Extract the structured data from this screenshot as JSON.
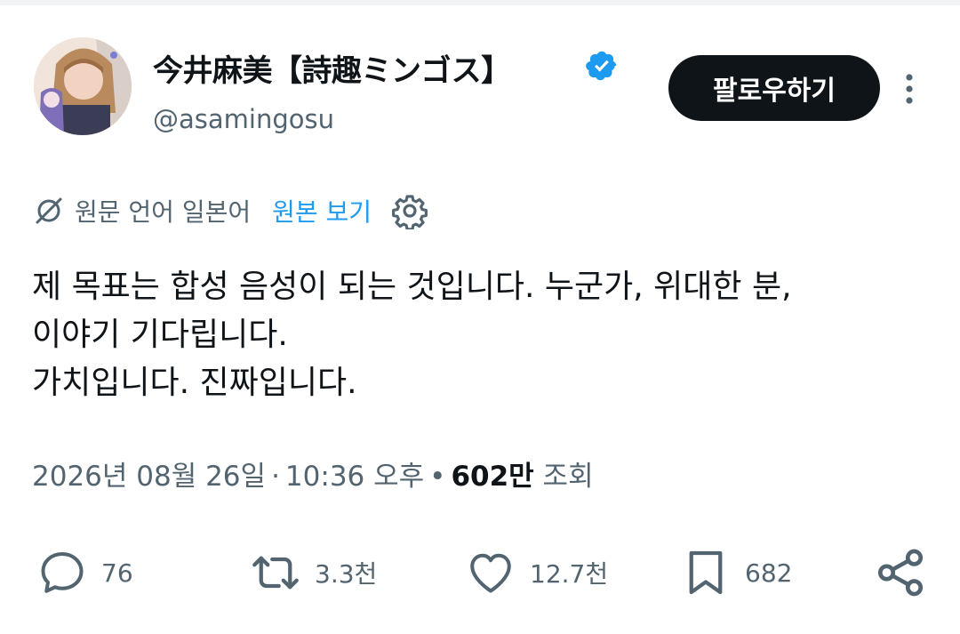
{
  "author": {
    "display_name": "今井麻美【詩趣ミンゴス】",
    "handle": "@asamingosu",
    "verified": true
  },
  "follow_button": {
    "label": "팔로우하기"
  },
  "translation": {
    "label": "원문 언어 일본어",
    "show_original_label": "원본 보기"
  },
  "tweet": {
    "lines": [
      "제 목표는 합성 음성이 되는 것입니다. 누군가, 위대한 분,",
      "이야기 기다립니다.",
      "가치입니다. 진짜입니다."
    ]
  },
  "meta": {
    "date": "2026년 08월 26일",
    "time": "10:36 오후",
    "views_count": "602만",
    "views_label": "조회"
  },
  "actions": {
    "replies": "76",
    "retweets": "3.3천",
    "likes": "12.7천",
    "bookmarks": "682"
  },
  "colors": {
    "text": "#0f1419",
    "secondary": "#536471",
    "accent": "#1d9bf0",
    "button_bg": "#0f1419"
  },
  "icons": {
    "verified": "verified-badge-icon",
    "more": "more-vertical-icon",
    "translate": "translate-icon",
    "settings": "gear-icon",
    "reply": "reply-icon",
    "retweet": "retweet-icon",
    "like": "heart-icon",
    "bookmark": "bookmark-icon",
    "share": "share-icon"
  }
}
